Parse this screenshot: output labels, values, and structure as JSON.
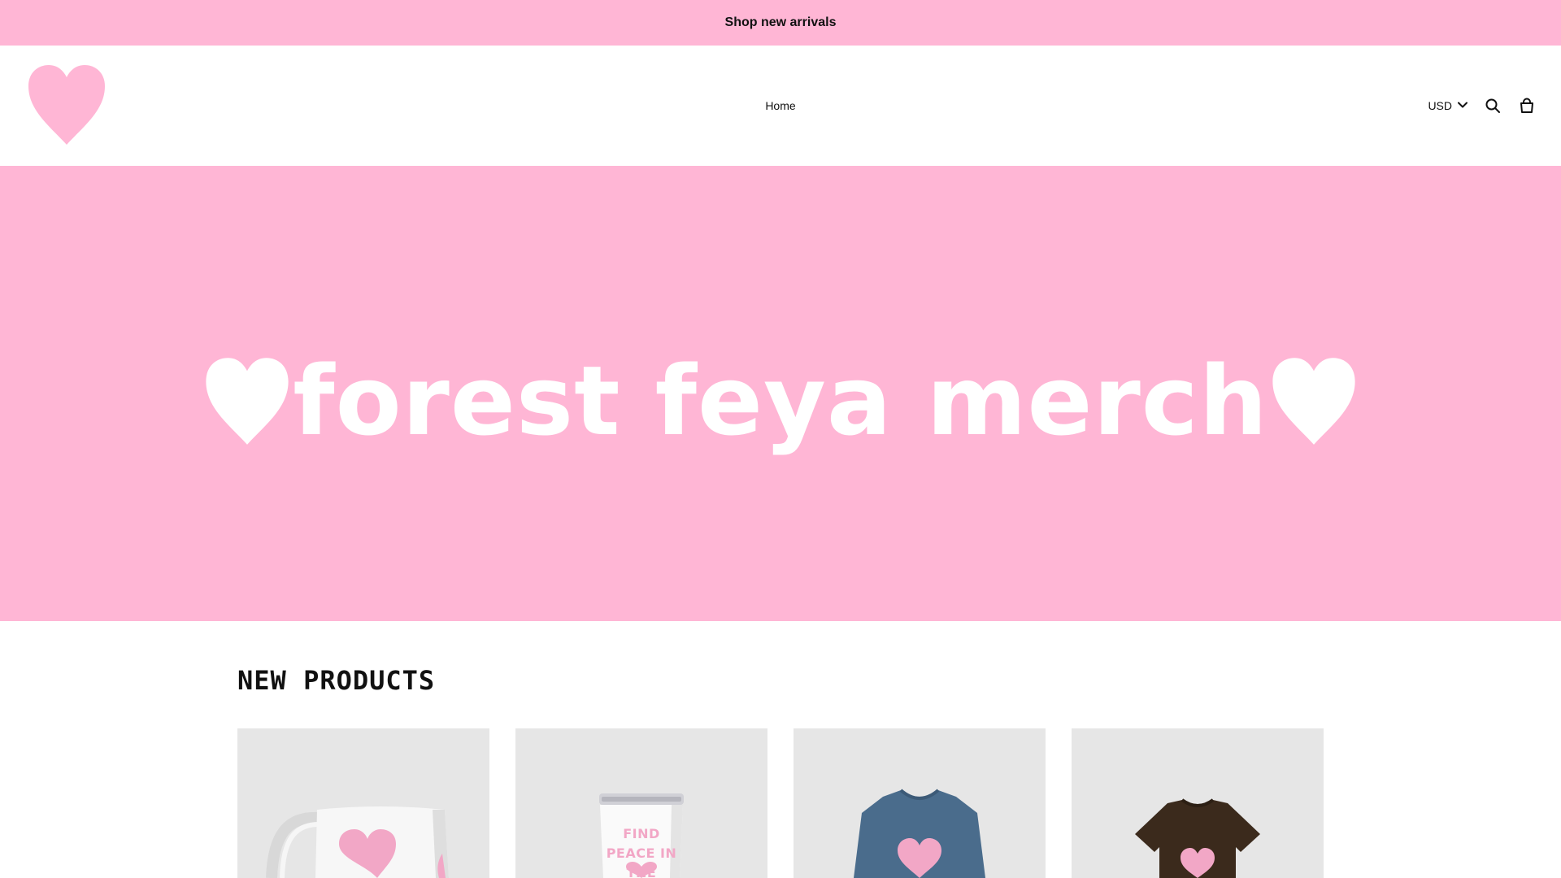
{
  "announcement": {
    "text": "Shop new arrivals"
  },
  "header": {
    "logo_icon": "heart-logo-icon",
    "nav": [
      {
        "label": "Home"
      }
    ],
    "currency": "USD",
    "icons": [
      "chevron-down-icon",
      "search-icon",
      "shopping-bag-icon"
    ]
  },
  "hero": {
    "title": "Forest Feya Merch",
    "icons": [
      "heart-icon",
      "heart-icon"
    ]
  },
  "section": {
    "title": "NEW PRODUCTS"
  },
  "products": [
    {
      "image": "white-heart-mug",
      "text": ""
    },
    {
      "image": "white-tumbler",
      "text": "Find peace in the chaos"
    },
    {
      "image": "blue-heart-tshirt",
      "text": ""
    },
    {
      "image": "brown-heart-tshirt",
      "text": ""
    }
  ],
  "colors": {
    "brand_pink": "#ffb6d5",
    "heart_pink": "#ffb6d5",
    "card_bg": "#e6e6e6",
    "shirt_blue": "#4a6c8c",
    "shirt_brown": "#3b2a1c"
  }
}
